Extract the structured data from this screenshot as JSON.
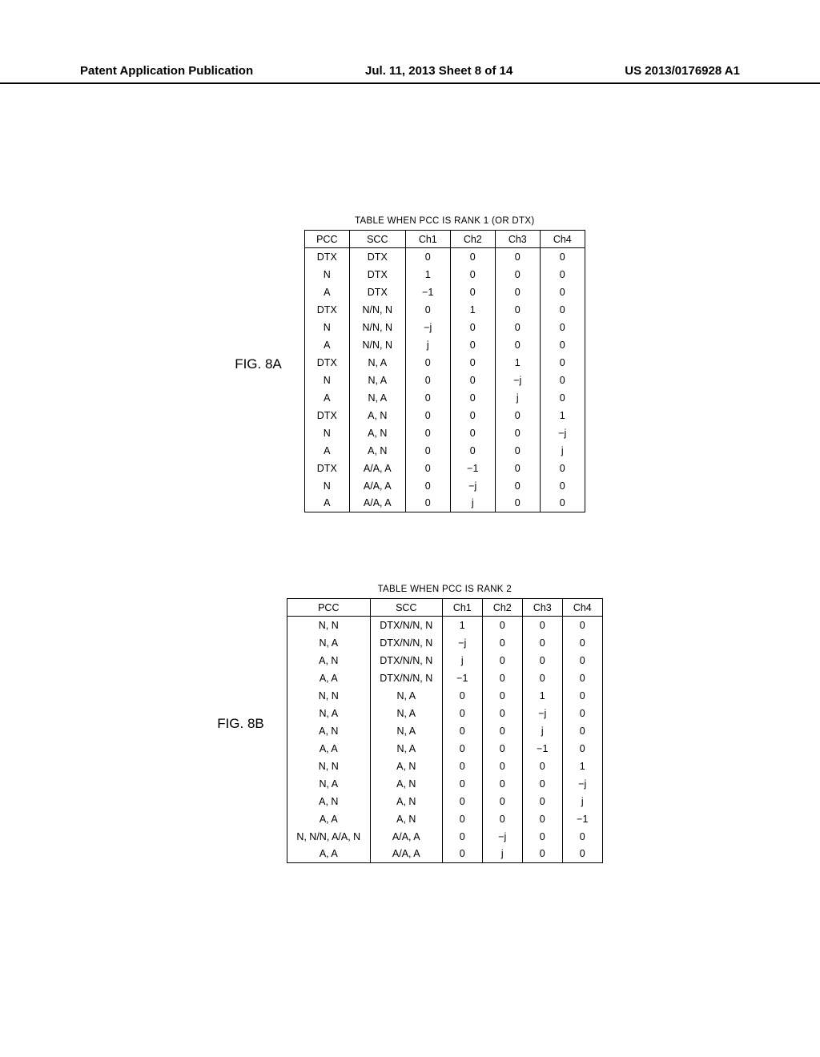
{
  "header": {
    "left": "Patent Application Publication",
    "center": "Jul. 11, 2013   Sheet 8 of 14",
    "right": "US 2013/0176928 A1"
  },
  "figA": {
    "label": "FIG. 8A",
    "caption": "TABLE WHEN PCC IS RANK 1 (OR DTX)",
    "headers": [
      "PCC",
      "SCC",
      "Ch1",
      "Ch2",
      "Ch3",
      "Ch4"
    ],
    "rows": [
      [
        "DTX",
        "DTX",
        "0",
        "0",
        "0",
        "0"
      ],
      [
        "N",
        "DTX",
        "1",
        "0",
        "0",
        "0"
      ],
      [
        "A",
        "DTX",
        "−1",
        "0",
        "0",
        "0"
      ],
      [
        "DTX",
        "N/N, N",
        "0",
        "1",
        "0",
        "0"
      ],
      [
        "N",
        "N/N, N",
        "−j",
        "0",
        "0",
        "0"
      ],
      [
        "A",
        "N/N, N",
        "j",
        "0",
        "0",
        "0"
      ],
      [
        "DTX",
        "N, A",
        "0",
        "0",
        "1",
        "0"
      ],
      [
        "N",
        "N, A",
        "0",
        "0",
        "−j",
        "0"
      ],
      [
        "A",
        "N, A",
        "0",
        "0",
        "j",
        "0"
      ],
      [
        "DTX",
        "A, N",
        "0",
        "0",
        "0",
        "1"
      ],
      [
        "N",
        "A, N",
        "0",
        "0",
        "0",
        "−j"
      ],
      [
        "A",
        "A, N",
        "0",
        "0",
        "0",
        "j"
      ],
      [
        "DTX",
        "A/A, A",
        "0",
        "−1",
        "0",
        "0"
      ],
      [
        "N",
        "A/A, A",
        "0",
        "−j",
        "0",
        "0"
      ],
      [
        "A",
        "A/A, A",
        "0",
        "j",
        "0",
        "0"
      ]
    ]
  },
  "figB": {
    "label": "FIG. 8B",
    "caption": "TABLE WHEN PCC IS RANK 2",
    "headers": [
      "PCC",
      "SCC",
      "Ch1",
      "Ch2",
      "Ch3",
      "Ch4"
    ],
    "rows": [
      [
        "N, N",
        "DTX/N/N, N",
        "1",
        "0",
        "0",
        "0"
      ],
      [
        "N, A",
        "DTX/N/N, N",
        "−j",
        "0",
        "0",
        "0"
      ],
      [
        "A, N",
        "DTX/N/N, N",
        "j",
        "0",
        "0",
        "0"
      ],
      [
        "A, A",
        "DTX/N/N, N",
        "−1",
        "0",
        "0",
        "0"
      ],
      [
        "N, N",
        "N, A",
        "0",
        "0",
        "1",
        "0"
      ],
      [
        "N, A",
        "N, A",
        "0",
        "0",
        "−j",
        "0"
      ],
      [
        "A, N",
        "N, A",
        "0",
        "0",
        "j",
        "0"
      ],
      [
        "A, A",
        "N, A",
        "0",
        "0",
        "−1",
        "0"
      ],
      [
        "N, N",
        "A, N",
        "0",
        "0",
        "0",
        "1"
      ],
      [
        "N, A",
        "A, N",
        "0",
        "0",
        "0",
        "−j"
      ],
      [
        "A, N",
        "A, N",
        "0",
        "0",
        "0",
        "j"
      ],
      [
        "A, A",
        "A, N",
        "0",
        "0",
        "0",
        "−1"
      ],
      [
        "N, N/N, A/A, N",
        "A/A, A",
        "0",
        "−j",
        "0",
        "0"
      ],
      [
        "A, A",
        "A/A, A",
        "0",
        "j",
        "0",
        "0"
      ]
    ]
  }
}
